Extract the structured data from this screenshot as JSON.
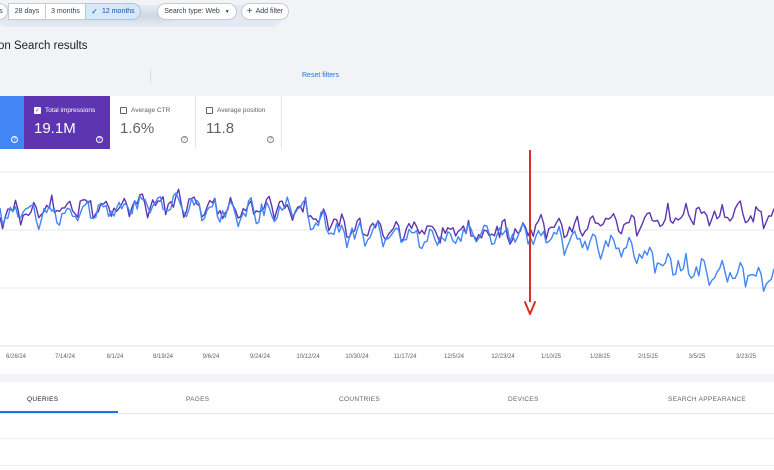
{
  "header": {
    "page_title": "on Search results"
  },
  "filters": {
    "date_ranges": [
      {
        "label": "s",
        "selected": false
      },
      {
        "label": "28 days",
        "selected": false
      },
      {
        "label": "3 months",
        "selected": false
      },
      {
        "label": "12 months",
        "selected": true
      }
    ],
    "search_type": "Search type: Web",
    "add_filter": "Add filter",
    "reset": "Reset filters"
  },
  "metrics": [
    {
      "label": "",
      "value": "",
      "checked": true,
      "color": "#4285f4"
    },
    {
      "label": "Total impressions",
      "value": "19.1M",
      "checked": true,
      "color": "#5e35b1"
    },
    {
      "label": "Average CTR",
      "value": "1.6%",
      "checked": false
    },
    {
      "label": "Average position",
      "value": "11.8",
      "checked": false
    }
  ],
  "colors": {
    "clicks": "#4285f4",
    "impressions": "#5e35b1",
    "annotation_arrow": "#d93025"
  },
  "chart_data": {
    "type": "line",
    "x_tick_labels": [
      "6/26/24",
      "7/14/24",
      "8/1/24",
      "8/19/24",
      "9/6/24",
      "9/24/24",
      "10/12/24",
      "10/30/24",
      "11/17/24",
      "12/5/24",
      "12/23/24",
      "1/10/25",
      "1/28/25",
      "2/15/25",
      "3/5/25",
      "3/23/25"
    ],
    "series": [
      {
        "key": "impressions",
        "color": "#5e35b1",
        "start": 215,
        "seed": 11,
        "segments": [
          [
            0,
            0
          ],
          [
            0.05,
            -5
          ],
          [
            0.1,
            -8
          ],
          [
            0.22,
            -12
          ],
          [
            0.3,
            -6
          ],
          [
            0.38,
            -8
          ],
          [
            0.44,
            12
          ],
          [
            0.55,
            16
          ],
          [
            0.62,
            18
          ],
          [
            0.7,
            14
          ],
          [
            0.8,
            8
          ],
          [
            0.9,
            0
          ],
          [
            1.0,
            2
          ]
        ]
      },
      {
        "key": "clicks",
        "color": "#4285f4",
        "start": 210,
        "seed": 29,
        "segments": [
          [
            0,
            0
          ],
          [
            0.05,
            5
          ],
          [
            0.1,
            4
          ],
          [
            0.22,
            -8
          ],
          [
            0.3,
            2
          ],
          [
            0.38,
            -2
          ],
          [
            0.44,
            22
          ],
          [
            0.55,
            28
          ],
          [
            0.62,
            22
          ],
          [
            0.7,
            28
          ],
          [
            0.8,
            36
          ],
          [
            0.88,
            58
          ],
          [
            1.0,
            68
          ]
        ]
      }
    ],
    "grid": true,
    "annotation": "red downward arrow near 1/10/25"
  },
  "tabs": [
    {
      "label": "QUERIES",
      "active": true
    },
    {
      "label": "PAGES",
      "active": false
    },
    {
      "label": "COUNTRIES",
      "active": false
    },
    {
      "label": "DEVICES",
      "active": false
    },
    {
      "label": "SEARCH APPEARANCE",
      "active": false
    }
  ]
}
